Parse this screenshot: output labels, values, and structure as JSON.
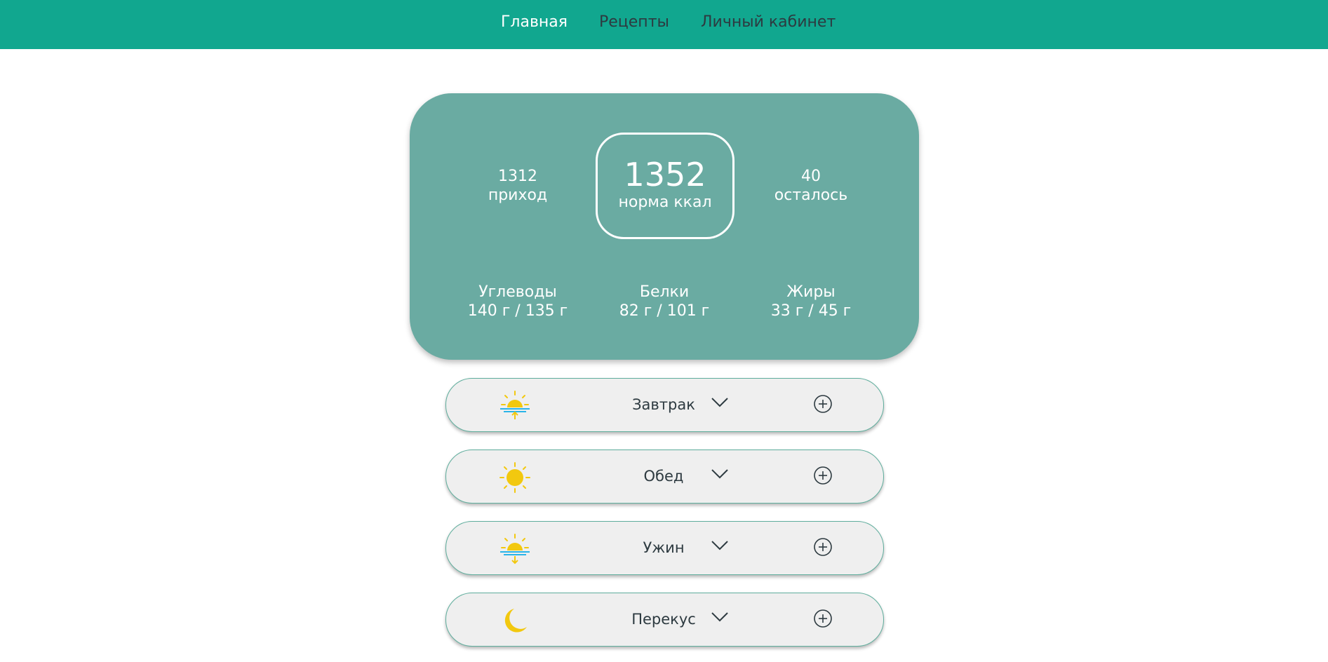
{
  "nav": {
    "items": [
      "Главная",
      "Рецепты",
      "Личный кабинет"
    ],
    "active_index": 0
  },
  "summary": {
    "intake": {
      "value": "1312",
      "label": "приход"
    },
    "norm": {
      "value": "1352",
      "label": "норма ккал"
    },
    "remaining": {
      "value": "40",
      "label": "осталось"
    },
    "macros": [
      {
        "label": "Углеводы",
        "value": "140 г / 135 г"
      },
      {
        "label": "Белки",
        "value": "82 г / 101 г"
      },
      {
        "label": "Жиры",
        "value": "33 г / 45 г"
      }
    ]
  },
  "meals": [
    {
      "label": "Завтрак",
      "icon": "sunrise-icon"
    },
    {
      "label": "Обед",
      "icon": "sun-icon"
    },
    {
      "label": "Ужин",
      "icon": "sunset-icon"
    },
    {
      "label": "Перекус",
      "icon": "moon-icon"
    }
  ],
  "colors": {
    "nav_bg": "#11a78f",
    "card_bg": "#6aaba2",
    "meal_bg": "#efefef",
    "sun": "#f2c80f",
    "water": "#2ab4e8",
    "arrow": "#f2c80f"
  }
}
